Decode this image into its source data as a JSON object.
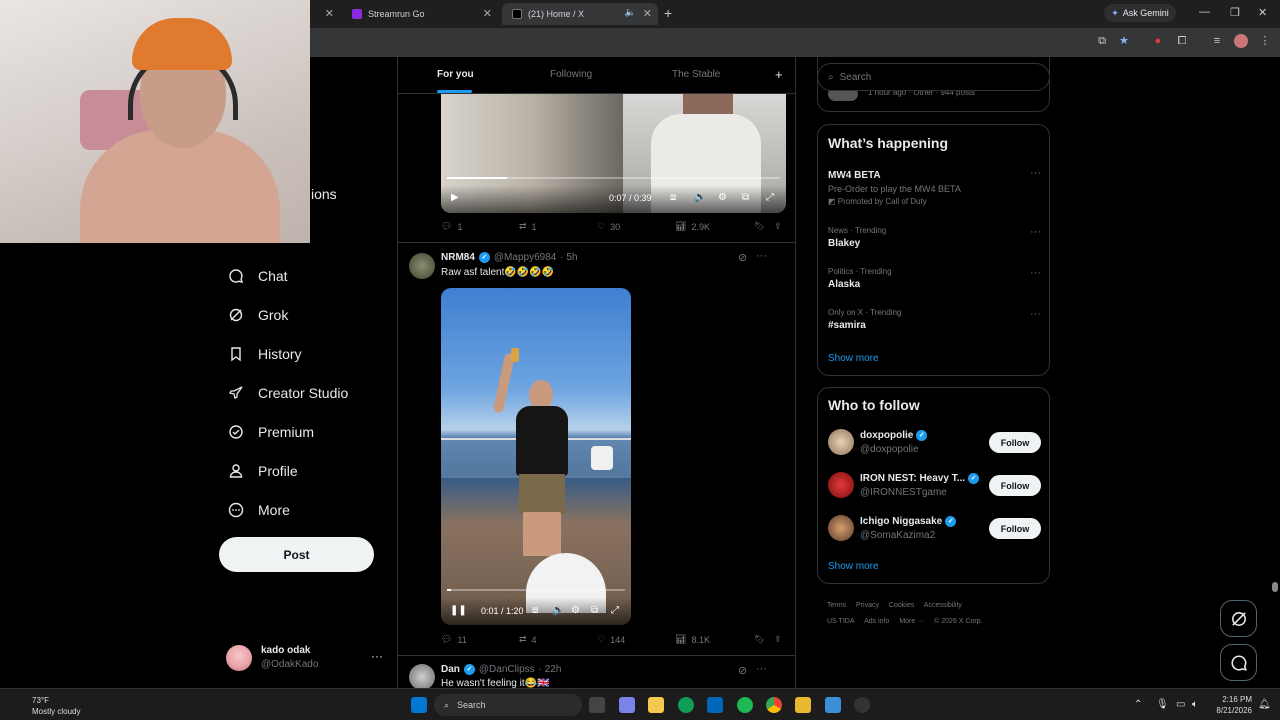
{
  "browser": {
    "tabs": [
      {
        "label": "Streamrun Go"
      },
      {
        "label": "(21) Home / X"
      }
    ],
    "ask_gemini": "Ask Gemini"
  },
  "nav": {
    "partial_item": "ions",
    "items": [
      {
        "label": "Chat"
      },
      {
        "label": "Grok"
      },
      {
        "label": "History"
      },
      {
        "label": "Creator Studio"
      },
      {
        "label": "Premium"
      },
      {
        "label": "Profile"
      },
      {
        "label": "More"
      }
    ],
    "post_button": "Post"
  },
  "account": {
    "name": "kado odak",
    "handle": "@OdakKado"
  },
  "feed": {
    "tabs": [
      "For you",
      "Following",
      "The Stable"
    ],
    "tweets": [
      {
        "video_time": "0:07 / 0:39",
        "replies": "1",
        "reposts": "1",
        "likes": "30",
        "views": "2.9K"
      },
      {
        "name": "NRM84",
        "handle": "@Mappy6984",
        "time": "· 5h",
        "text": "Raw asf talent🤣🤣🤣🤣",
        "video_time": "0:01 / 1:20",
        "replies": "11",
        "reposts": "4",
        "likes": "144",
        "views": "8.1K"
      },
      {
        "name": "Dan",
        "handle": "@DanClipss",
        "time": "· 22h",
        "text": "He wasn't feeling it😂🇬🇧"
      }
    ]
  },
  "sidebar": {
    "search_placeholder": "Search",
    "prev_item_meta": "1 hour ago · Other · 944 posts",
    "whats_happening": {
      "title": "What’s happening",
      "trends": [
        {
          "meta": "",
          "title": "MW4 BETA",
          "sub": "Pre-Order to play the MW4 BETA",
          "promo": "Promoted by Call of Duty"
        },
        {
          "meta": "News · Trending",
          "title": "Blakey"
        },
        {
          "meta": "Politics · Trending",
          "title": "Alaska"
        },
        {
          "meta": "Only on X · Trending",
          "title": "#samira"
        }
      ],
      "show_more": "Show more"
    },
    "who_to_follow": {
      "title": "Who to follow",
      "accounts": [
        {
          "name": "doxpopolie",
          "handle": "@doxpopolie",
          "button": "Follow"
        },
        {
          "name": "IRON NEST: Heavy T...",
          "handle": "@IRONNESTgame",
          "button": "Follow"
        },
        {
          "name": "Ichigo Niggasake",
          "handle": "@SomaKazima2",
          "button": "Follow"
        }
      ],
      "show_more": "Show more"
    },
    "footer": [
      "Terms",
      "Privacy",
      "Cookies",
      "Accessibility",
      "Ads info",
      "More ···",
      "© 2026 X Corp."
    ],
    "footer_extra": "US TIDA"
  },
  "taskbar": {
    "temp": "73°F",
    "weather": "Mostly cloudy",
    "search": "Search",
    "time": "2:16 PM",
    "date": "8/21/2026"
  },
  "colors": {
    "accent": "#1d9bf0",
    "background": "#000000",
    "border": "#2f3336",
    "muted": "#71767b"
  }
}
